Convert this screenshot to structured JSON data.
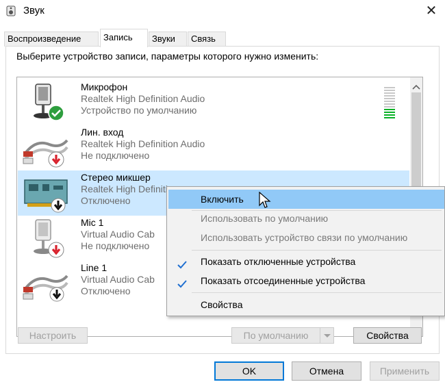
{
  "window": {
    "title": "Звук",
    "close_glyph": "✕",
    "icon": "speaker-icon"
  },
  "tabs": [
    {
      "label": "Воспроизведение",
      "active": false
    },
    {
      "label": "Запись",
      "active": true
    },
    {
      "label": "Звуки",
      "active": false
    },
    {
      "label": "Связь",
      "active": false
    }
  ],
  "instruction": "Выберите устройство записи, параметры которого нужно изменить:",
  "devices": [
    {
      "name": "Микрофон",
      "driver": "Realtek High Definition Audio",
      "status": "Устройство по умолчанию",
      "icon": "microphone-icon",
      "badge": "check-badge-icon"
    },
    {
      "name": "Лин. вход",
      "driver": "Realtek High Definition Audio",
      "status": "Не подключено",
      "icon": "line-in-cable-icon",
      "badge": "red-down-arrow-badge-icon"
    },
    {
      "name": "Стерео микшер",
      "driver": "Realtek High Definiti",
      "status": "Отключено",
      "icon": "sound-card-icon",
      "badge": "black-down-arrow-badge-icon"
    },
    {
      "name": "Mic 1",
      "driver": "Virtual Audio Cab",
      "status": "Не подключено",
      "icon": "microphone-icon",
      "badge": "red-down-arrow-badge-icon"
    },
    {
      "name": "Line 1",
      "driver": "Virtual Audio Cab",
      "status": "Отключено",
      "icon": "line-in-cable-icon",
      "badge": "black-down-arrow-badge-icon"
    }
  ],
  "level_meter": {
    "fraction": 0.3
  },
  "context_menu": {
    "items": [
      {
        "label": "Включить",
        "highlight": true,
        "disabled": false,
        "checked": false
      },
      {
        "label": "Использовать по умолчанию",
        "highlight": false,
        "disabled": true,
        "checked": false
      },
      {
        "label": "Использовать устройство связи по умолчанию",
        "highlight": false,
        "disabled": true,
        "checked": false
      },
      {
        "label": "Показать отключенные устройства",
        "highlight": false,
        "disabled": false,
        "checked": true
      },
      {
        "label": "Показать отсоединенные устройства",
        "highlight": false,
        "disabled": false,
        "checked": true
      },
      {
        "label": "Свойства",
        "highlight": false,
        "disabled": false,
        "checked": false
      }
    ]
  },
  "buttons": {
    "configure": "Настроить",
    "set_default": "По умолчанию",
    "properties": "Свойства",
    "ok": "OK",
    "cancel": "Отмена",
    "apply": "Применить"
  },
  "colors": {
    "selection": "#cce8ff",
    "menu_highlight": "#91c9f7",
    "primary_border": "#0078d7",
    "check_green": "#2e9e3e",
    "arrow_red": "#d9232e",
    "check_blue": "#1f6fd1"
  }
}
